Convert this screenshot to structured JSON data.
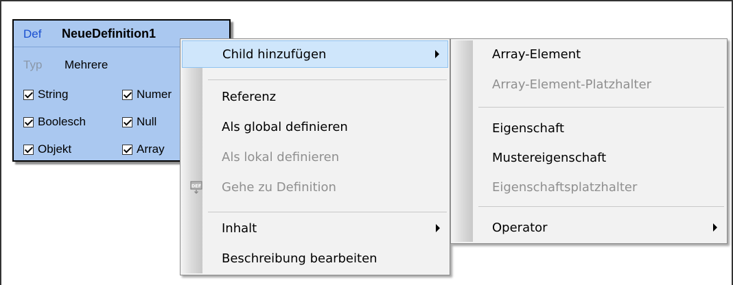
{
  "definition": {
    "tag": "Def",
    "name": "NeueDefinition1",
    "type_label": "Typ",
    "type_value": "Mehrere",
    "checkboxes": [
      {
        "label": "String",
        "checked": true
      },
      {
        "label": "Numer",
        "checked": true
      },
      {
        "label": "Boolesch",
        "checked": true
      },
      {
        "label": "Null",
        "checked": true
      },
      {
        "label": "Objekt",
        "checked": true
      },
      {
        "label": "Array",
        "checked": true
      }
    ]
  },
  "context_menu": {
    "items": [
      {
        "label": "Child hinzufügen",
        "enabled": true,
        "submenu": true,
        "highlighted": true
      },
      {
        "label": "Referenz",
        "enabled": true
      },
      {
        "label": "Als global definieren",
        "enabled": true
      },
      {
        "label": "Als lokal definieren",
        "enabled": false
      },
      {
        "label": "Gehe zu Definition",
        "enabled": false,
        "icon": "def-icon"
      },
      {
        "label": "Inhalt",
        "enabled": true,
        "submenu": true
      },
      {
        "label": "Beschreibung bearbeiten",
        "enabled": true
      }
    ]
  },
  "submenu": {
    "items": [
      {
        "label": "Array-Element",
        "enabled": true
      },
      {
        "label": "Array-Element-Platzhalter",
        "enabled": false
      },
      {
        "label": "Eigenschaft",
        "enabled": true
      },
      {
        "label": "Mustereigenschaft",
        "enabled": true
      },
      {
        "label": "Eigenschaftsplatzhalter",
        "enabled": false
      },
      {
        "label": "Operator",
        "enabled": true,
        "submenu": true
      }
    ]
  },
  "colors": {
    "definition_bg": "#aac8f0",
    "def_tag": "#1a4fd0",
    "menu_bg": "#f2f2f2",
    "highlight": "#cfe6fb",
    "disabled_text": "#8f8f8f"
  }
}
